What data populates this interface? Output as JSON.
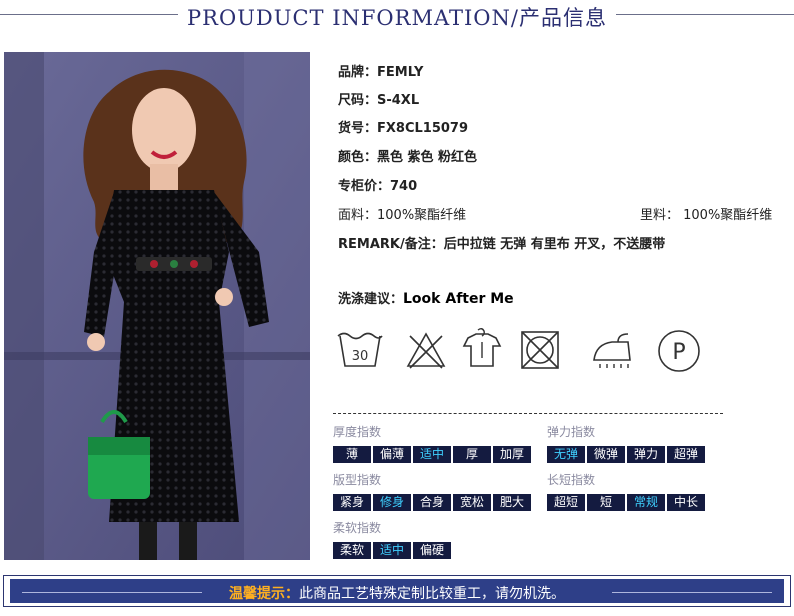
{
  "header": {
    "title": "PROUDUCT INFORMATION/产品信息"
  },
  "product": {
    "brand": "品牌：FEMLY",
    "size": "尺码：S-4XL",
    "sku": "货号：FX8CL15079",
    "color": "颜色：黑色 紫色 粉红色",
    "price": "专柜价：740",
    "fabric": "面料：100%聚酯纤维",
    "lining": "里料： 100%聚酯纤维",
    "remark": "REMARK/备注：后中拉链 无弹 有里布 开叉，不送腰带"
  },
  "care": {
    "label": "洗涤建议：",
    "value": "Look After Me",
    "wash_temp": "30",
    "icons": [
      "wash-30-icon",
      "no-bleach-icon",
      "hang-dry-icon",
      "no-tumble-dry-icon",
      "steam-iron-icon",
      "dry-clean-p-icon"
    ],
    "dry_clean_letter": "P"
  },
  "indices": {
    "thickness": {
      "title": "厚度指数",
      "options": [
        "薄",
        "偏薄",
        "适中",
        "厚",
        "加厚"
      ],
      "selected": 2
    },
    "elasticity": {
      "title": "弹力指数",
      "options": [
        "无弹",
        "微弹",
        "弹力",
        "超弹"
      ],
      "selected": 0
    },
    "fit": {
      "title": "版型指数",
      "options": [
        "紧身",
        "修身",
        "合身",
        "宽松",
        "肥大"
      ],
      "selected": 1
    },
    "length": {
      "title": "长短指数",
      "options": [
        "超短",
        "短",
        "常规",
        "中长"
      ],
      "selected": 2
    },
    "softness": {
      "title": "柔软指数",
      "options": [
        "柔软",
        "适中",
        "偏硬"
      ],
      "selected": 1
    }
  },
  "notice": {
    "label": "温馨提示：",
    "text": "此商品工艺特殊定制比较重工，请勿机洗。"
  },
  "colors": {
    "navy": "#141b40",
    "highlight": "#3fd0ff",
    "banner": "#2e3f88",
    "accent": "#ffb020"
  }
}
